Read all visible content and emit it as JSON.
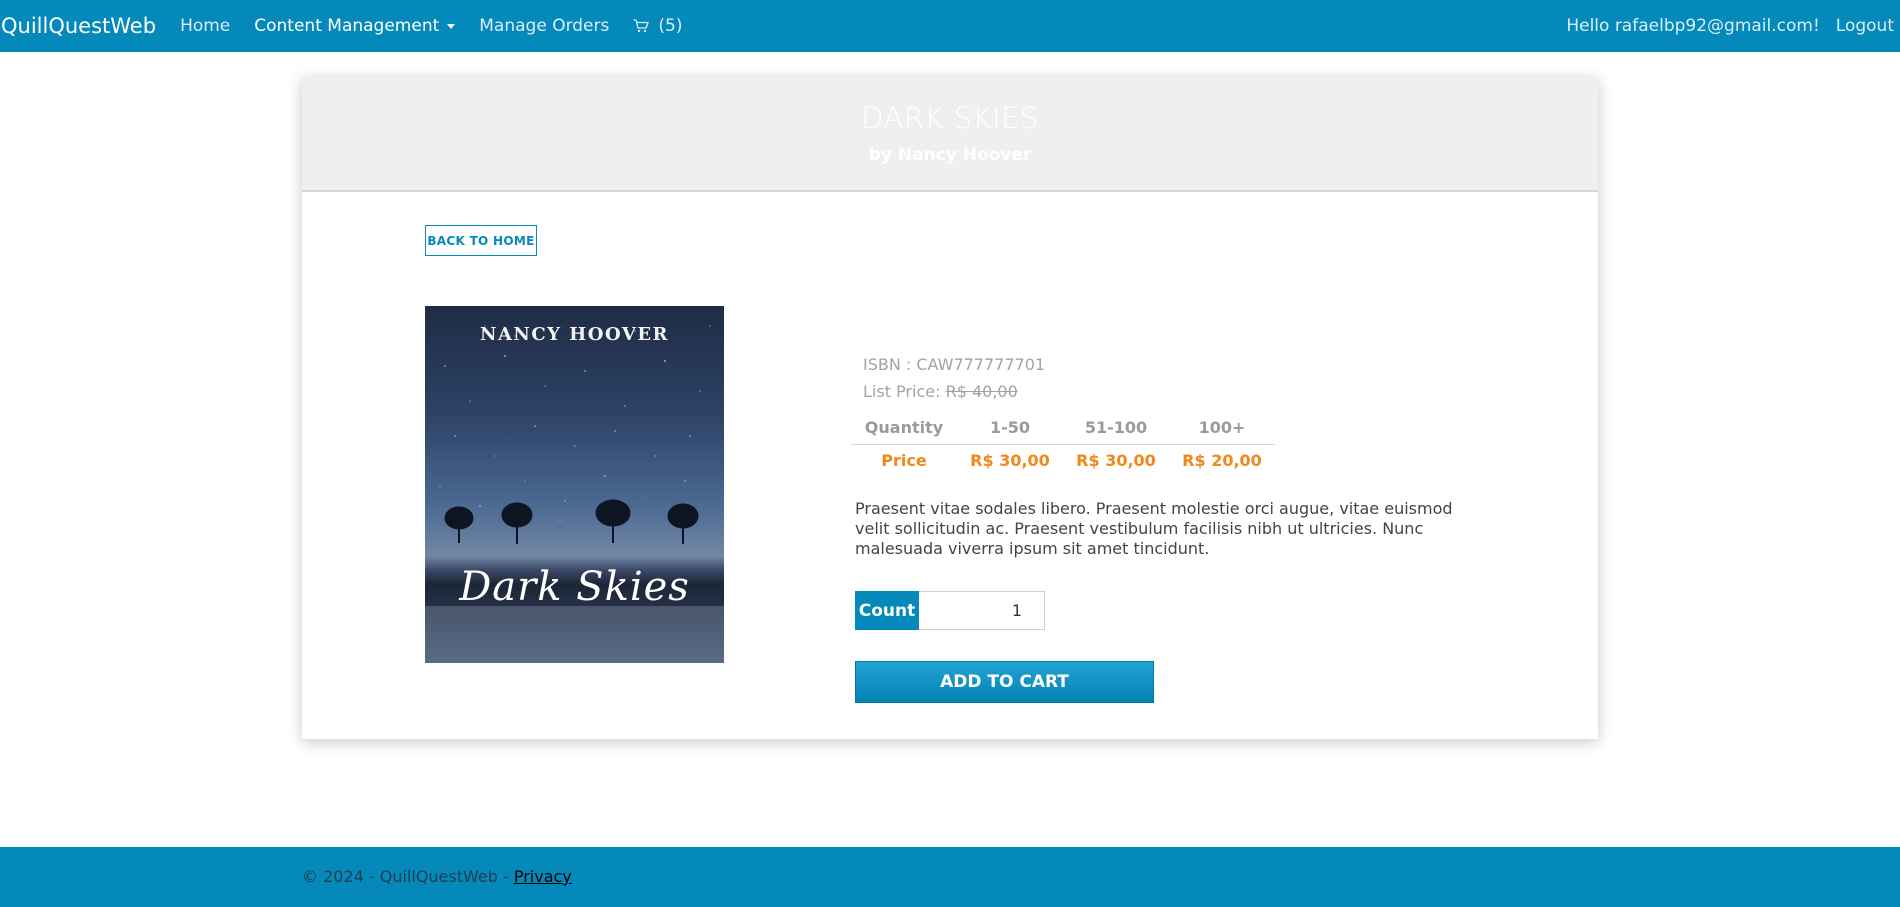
{
  "navbar": {
    "brand": "QuillQuestWeb",
    "home": "Home",
    "content_management": "Content Management",
    "manage_orders": "Manage Orders",
    "cart_count": "(5)",
    "greeting": "Hello rafaelbp92@gmail.com!",
    "logout": "Logout"
  },
  "book": {
    "title": "DARK SKIES",
    "author_line": "by Nancy Hoover",
    "cover_author": "NANCY HOOVER",
    "cover_title": "Dark Skies",
    "isbn": "ISBN : CAW777777701",
    "list_price_label": "List Price:",
    "list_price_value": "R$ 40,00",
    "description": "Praesent vitae sodales libero. Praesent molestie orci augue, vitae euismod velit sollicitudin ac. Praesent vestibulum facilisis nibh ut ultricies. Nunc malesuada viverra ipsum sit amet tincidunt."
  },
  "pricing": {
    "quantity_label": "Quantity",
    "price_label": "Price",
    "tiers": [
      {
        "range": "1-50",
        "price": "R$ 30,00"
      },
      {
        "range": "51-100",
        "price": "R$ 30,00"
      },
      {
        "range": "100+",
        "price": "R$ 20,00"
      }
    ]
  },
  "actions": {
    "back_to_home": "BACK TO HOME",
    "count_label": "Count",
    "count_value": "1",
    "add_to_cart": "ADD TO CART"
  },
  "footer": {
    "text": "© 2024 - QuillQuestWeb - ",
    "privacy": "Privacy"
  },
  "colors": {
    "primary": "#0589bb",
    "price_accent": "#f0881c"
  },
  "icons": {
    "cart": "cart-icon",
    "dropdown": "caret-down-icon"
  }
}
